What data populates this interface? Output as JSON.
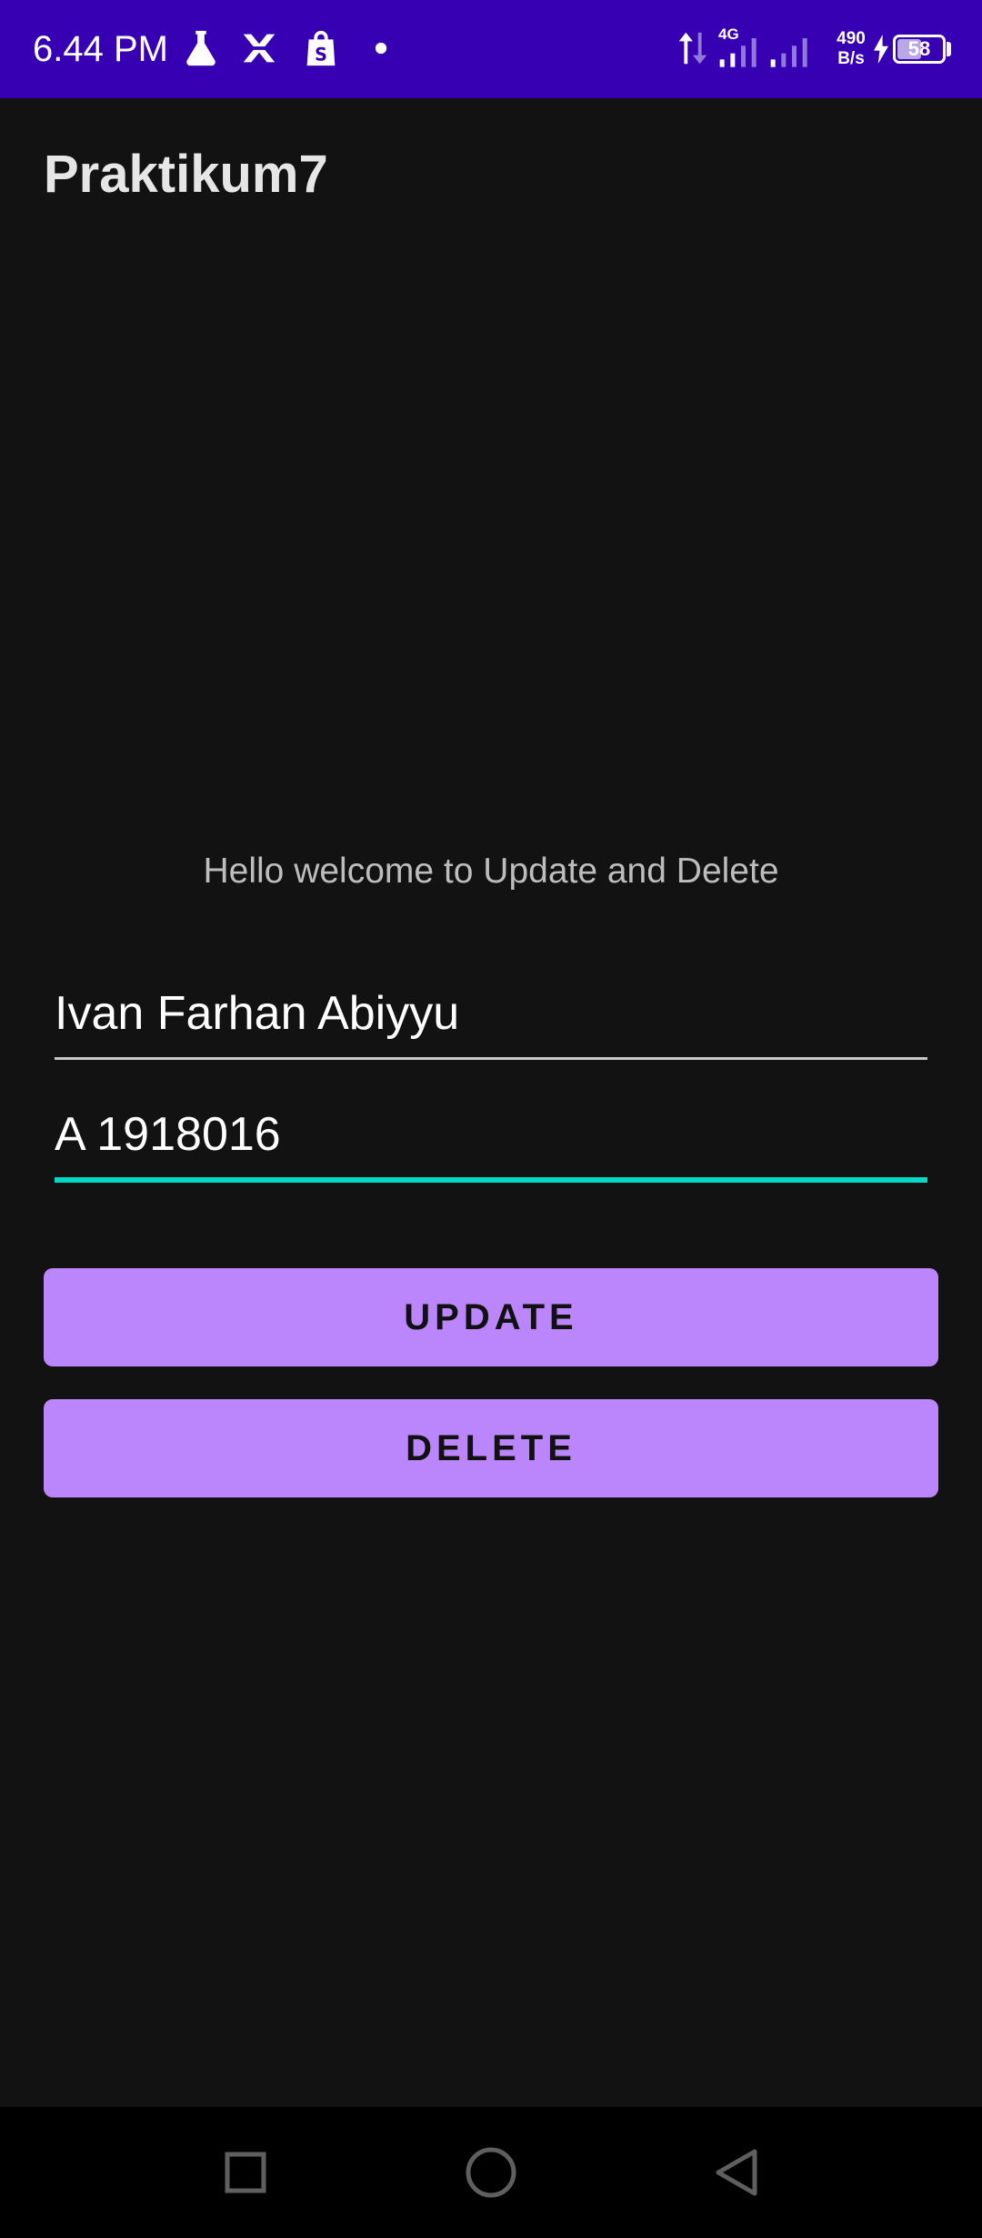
{
  "status_bar": {
    "time": "6.44 PM",
    "net_speed_value": "490",
    "net_speed_unit": "B/s",
    "network_type": "4G",
    "battery_level": "58",
    "battery_fraction": 0.58,
    "background_color": "#3700b3",
    "icons": [
      "flask-icon",
      "x-app-icon",
      "shopping-bag-icon",
      "dot-icon",
      "data-arrows-icon",
      "signal-icon",
      "signal-icon",
      "charging-icon",
      "battery-icon"
    ]
  },
  "app_bar": {
    "title": "Praktikum7"
  },
  "main": {
    "welcome_text": "Hello welcome to Update and Delete",
    "name_field_value": "Ivan Farhan Abiyyu",
    "nim_field_value": "A 1918016",
    "update_label": "UPDATE",
    "delete_label": "DELETE"
  },
  "colors": {
    "background": "#121212",
    "button": "#bb86fc",
    "focus_underline": "#03dac5"
  },
  "nav_bar": {
    "icons": [
      "recents-square-icon",
      "home-circle-icon",
      "back-triangle-icon"
    ]
  }
}
